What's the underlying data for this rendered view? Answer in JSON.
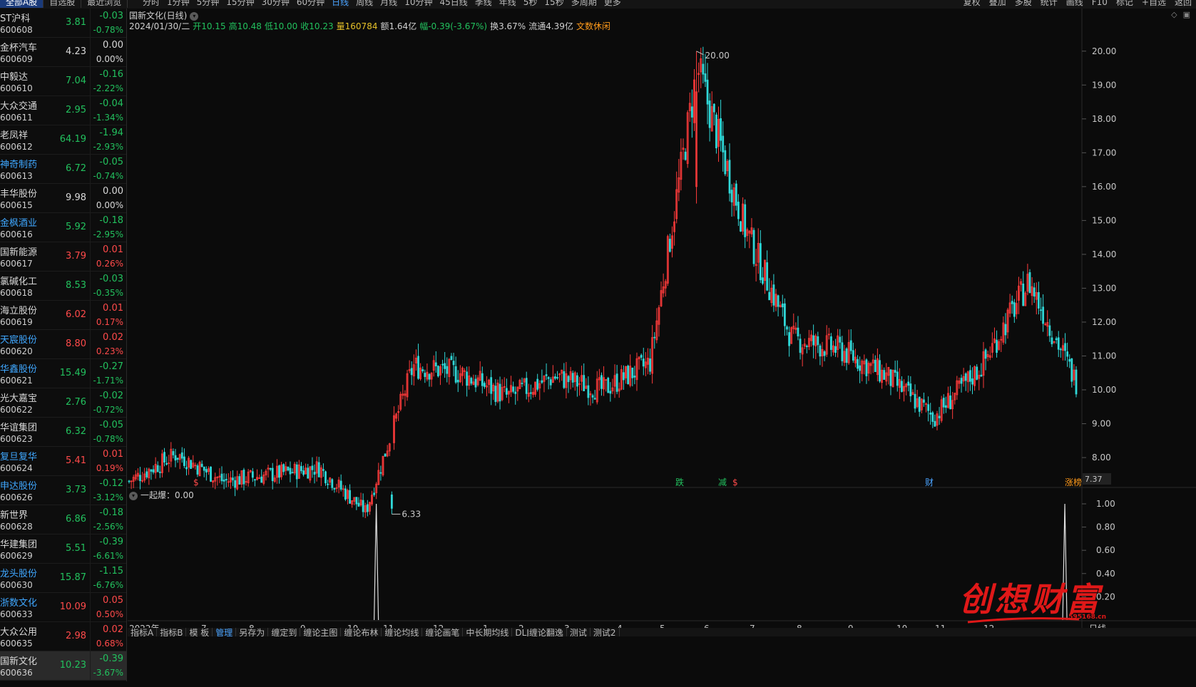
{
  "topbar": {
    "left_tabs": [
      {
        "label": "全部A股",
        "active": true
      },
      {
        "label": "自选股",
        "active": false
      },
      {
        "label": "最近浏览",
        "active": false
      }
    ],
    "periods": [
      "分时",
      "1分钟",
      "5分钟",
      "15分钟",
      "30分钟",
      "60分钟",
      "日线",
      "周线",
      "月线",
      "10分钟",
      "45日线",
      "季线",
      "年线",
      "5秒",
      "15秒",
      "多周期",
      "更多"
    ],
    "active_period": "日线",
    "right_tools": [
      "复权",
      "叠加",
      "多股",
      "统计",
      "画线",
      "F10",
      "标记",
      "+自选",
      "返回"
    ]
  },
  "watchlist": [
    {
      "name": "ST沪科",
      "code": "600608",
      "price": "3.81",
      "change": "-0.03",
      "pct": "-0.78%",
      "dir": "down",
      "highlight": false
    },
    {
      "name": "金杯汽车",
      "code": "600609",
      "price": "4.23",
      "change": "0.00",
      "pct": "0.00%",
      "dir": "flat",
      "highlight": false
    },
    {
      "name": "中毅达",
      "code": "600610",
      "price": "7.04",
      "change": "-0.16",
      "pct": "-2.22%",
      "dir": "down",
      "highlight": false
    },
    {
      "name": "大众交通",
      "code": "600611",
      "price": "2.95",
      "change": "-0.04",
      "pct": "-1.34%",
      "dir": "down",
      "highlight": false
    },
    {
      "name": "老凤祥",
      "code": "600612",
      "price": "64.19",
      "change": "-1.94",
      "pct": "-2.93%",
      "dir": "down",
      "highlight": false
    },
    {
      "name": "神奇制药",
      "code": "600613",
      "price": "6.72",
      "change": "-0.05",
      "pct": "-0.74%",
      "dir": "down",
      "highlight": true
    },
    {
      "name": "丰华股份",
      "code": "600615",
      "price": "9.98",
      "change": "0.00",
      "pct": "0.00%",
      "dir": "flat",
      "highlight": false
    },
    {
      "name": "金枫酒业",
      "code": "600616",
      "price": "5.92",
      "change": "-0.18",
      "pct": "-2.95%",
      "dir": "down",
      "highlight": true
    },
    {
      "name": "国新能源",
      "code": "600617",
      "price": "3.79",
      "change": "0.01",
      "pct": "0.26%",
      "dir": "up",
      "highlight": false
    },
    {
      "name": "氯碱化工",
      "code": "600618",
      "price": "8.53",
      "change": "-0.03",
      "pct": "-0.35%",
      "dir": "down",
      "highlight": false
    },
    {
      "name": "海立股份",
      "code": "600619",
      "price": "6.02",
      "change": "0.01",
      "pct": "0.17%",
      "dir": "up",
      "highlight": false
    },
    {
      "name": "天宸股份",
      "code": "600620",
      "price": "8.80",
      "change": "0.02",
      "pct": "0.23%",
      "dir": "up",
      "highlight": true
    },
    {
      "name": "华鑫股份",
      "code": "600621",
      "price": "15.49",
      "change": "-0.27",
      "pct": "-1.71%",
      "dir": "down",
      "highlight": true
    },
    {
      "name": "光大嘉宝",
      "code": "600622",
      "price": "2.76",
      "change": "-0.02",
      "pct": "-0.72%",
      "dir": "down",
      "highlight": false
    },
    {
      "name": "华谊集团",
      "code": "600623",
      "price": "6.32",
      "change": "-0.05",
      "pct": "-0.78%",
      "dir": "down",
      "highlight": false
    },
    {
      "name": "复旦复华",
      "code": "600624",
      "price": "5.41",
      "change": "0.01",
      "pct": "0.19%",
      "dir": "up",
      "highlight": true
    },
    {
      "name": "申达股份",
      "code": "600626",
      "price": "3.73",
      "change": "-0.12",
      "pct": "-3.12%",
      "dir": "down",
      "highlight": true
    },
    {
      "name": "新世界",
      "code": "600628",
      "price": "6.86",
      "change": "-0.18",
      "pct": "-2.56%",
      "dir": "down",
      "highlight": false
    },
    {
      "name": "华建集团",
      "code": "600629",
      "price": "5.51",
      "change": "-0.39",
      "pct": "-6.61%",
      "dir": "down",
      "highlight": false
    },
    {
      "name": "龙头股份",
      "code": "600630",
      "price": "15.87",
      "change": "-1.15",
      "pct": "-6.76%",
      "dir": "down",
      "highlight": true
    },
    {
      "name": "浙数文化",
      "code": "600633",
      "price": "10.09",
      "change": "0.05",
      "pct": "0.50%",
      "dir": "up",
      "highlight": true
    },
    {
      "name": "大众公用",
      "code": "600635",
      "price": "2.98",
      "change": "0.02",
      "pct": "0.68%",
      "dir": "up",
      "highlight": false
    },
    {
      "name": "国新文化",
      "code": "600636",
      "price": "10.23",
      "change": "-0.39",
      "pct": "-3.67%",
      "dir": "down",
      "highlight": false,
      "selected": true
    }
  ],
  "chart": {
    "title": "国新文化(日线)",
    "info": {
      "date": "2024/01/30/二",
      "open": "开10.15",
      "high": "高10.48",
      "low": "低10.00",
      "close": "收10.23",
      "vol": "量160784",
      "amount": "额1.64亿",
      "range": "幅-0.39(-3.67%)",
      "turnover": "换3.67%",
      "float_cap": "流通4.39亿",
      "concept": "文数休闲"
    },
    "high_label": "20.00",
    "low_label": "6.33",
    "last_price_tag": "7.37",
    "markers": [
      {
        "text": "$",
        "color": "#ff4a4a"
      },
      {
        "text": "跌",
        "color": "#22c15e"
      },
      {
        "text": "减",
        "color": "#22c15e"
      },
      {
        "text": "$",
        "color": "#ff4a4a"
      },
      {
        "text": "财",
        "color": "#4aa3ff"
      },
      {
        "text": "涨榜",
        "color": "#ff9a1a"
      }
    ],
    "sub_indicator": {
      "name": "一起爆",
      "value": "0.00"
    },
    "x_labels": [
      "2022年",
      "7",
      "8",
      "9",
      "10",
      "11",
      "12",
      "1",
      "2",
      "3",
      "4",
      "5",
      "6",
      "7",
      "8",
      "9",
      "10",
      "11",
      "12"
    ],
    "cursor_date": "2024/01/30/二",
    "x_right_label": "日线"
  },
  "chart_data": [
    {
      "type": "candlestick",
      "title": "国新文化(日线)",
      "ylim": [
        7.37,
        20.5
      ],
      "y_ticks": [
        8,
        9,
        10,
        11,
        12,
        13,
        14,
        15,
        16,
        17,
        18,
        19,
        20
      ],
      "approx_close_path": [
        {
          "t": "2022-05",
          "v": 7.3
        },
        {
          "t": "2022-06",
          "v": 8.1
        },
        {
          "t": "2022-07",
          "v": 7.3
        },
        {
          "t": "2022-08",
          "v": 7.5
        },
        {
          "t": "2022-09",
          "v": 7.7
        },
        {
          "t": "2022-10",
          "v": 6.4
        },
        {
          "t": "2022-11",
          "v": 10.7
        },
        {
          "t": "2022-12",
          "v": 10.5
        },
        {
          "t": "2023-01",
          "v": 9.8
        },
        {
          "t": "2023-02",
          "v": 10.4
        },
        {
          "t": "2023-03",
          "v": 10.0
        },
        {
          "t": "2023-04",
          "v": 10.8
        },
        {
          "t": "2023-05",
          "v": 19.5
        },
        {
          "t": "2023-06",
          "v": 14.8
        },
        {
          "t": "2023-07",
          "v": 11.5
        },
        {
          "t": "2023-08",
          "v": 11.2
        },
        {
          "t": "2023-09",
          "v": 10.4
        },
        {
          "t": "2023-10",
          "v": 9.2
        },
        {
          "t": "2023-11",
          "v": 10.7
        },
        {
          "t": "2023-12",
          "v": 13.2
        },
        {
          "t": "2024-01",
          "v": 10.23
        }
      ]
    },
    {
      "type": "bar",
      "title": "一起爆",
      "ylim": [
        0,
        1.0
      ],
      "y_ticks": [
        0.2,
        0.4,
        0.6,
        0.8,
        1.0
      ],
      "spikes": [
        {
          "t": "2022-11",
          "v": 1.0
        },
        {
          "t": "2024-01",
          "v": 1.0
        }
      ]
    }
  ],
  "bottombar": {
    "tabs": [
      "指标A",
      "指标B",
      "模 板",
      "管理",
      "另存为",
      "缠定到",
      "缠论主图",
      "缠论布林",
      "缠论均线",
      "缠论画笔",
      "中长期均线",
      "DLJ缠论翻逸",
      "测试",
      "测试2"
    ],
    "active": "管理"
  },
  "watermark": {
    "text": "创想财富",
    "url": "595168.cn"
  }
}
